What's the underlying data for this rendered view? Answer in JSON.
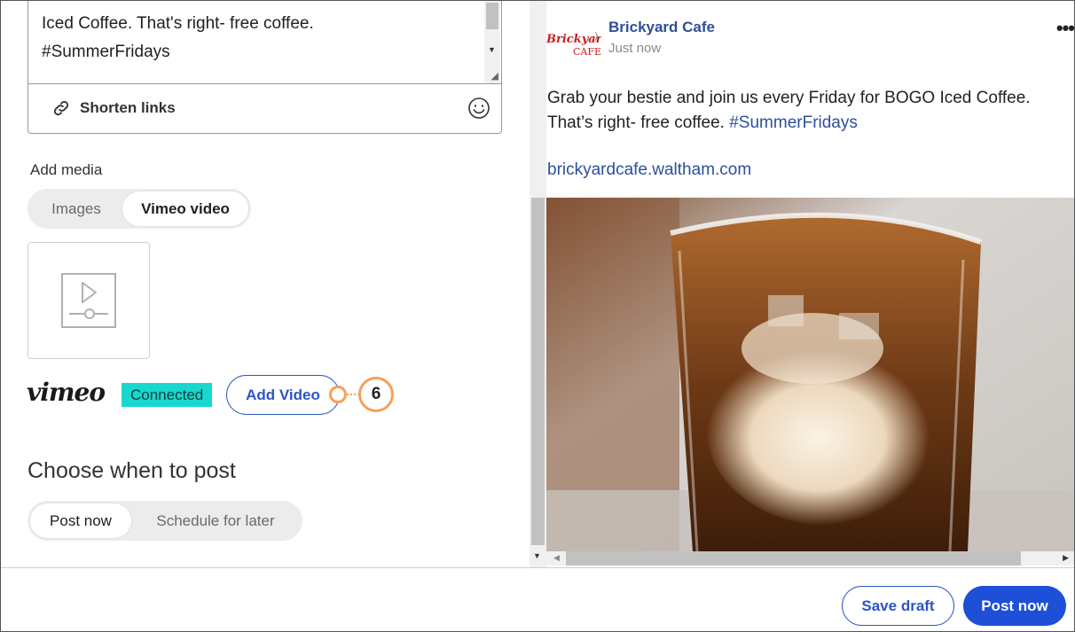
{
  "composer": {
    "text_lines": [
      "Iced Coffee. That's right- free coffee.",
      "#SummerFridays"
    ],
    "shorten_links_label": "Shorten links",
    "link_icon": "link-icon",
    "emoji_icon": "smiley-icon"
  },
  "media": {
    "label": "Add media",
    "tabs": [
      {
        "label": "Images",
        "selected": false
      },
      {
        "label": "Vimeo video",
        "selected": true
      }
    ],
    "thumb_icon": "video-placeholder-icon",
    "vimeo_logo_text": "vimeo",
    "connected_label": "Connected",
    "add_video_label": "Add Video",
    "callout_number": "6"
  },
  "schedule": {
    "title": "Choose when to post",
    "options": [
      {
        "label": "Post now",
        "selected": true
      },
      {
        "label": "Schedule for later",
        "selected": false
      }
    ]
  },
  "preview": {
    "page_name": "Brickyard Cafe",
    "time": "Just now",
    "logo_text_top": "Brickyard",
    "logo_text_bottom": "CAFE",
    "more_label": "•••",
    "body_text": "Grab your bestie and join us every Friday for BOGO Iced Coffee. That’s right- free coffee. ",
    "hashtag": "#SummerFridays",
    "link": "brickyardcafe.waltham.com",
    "image_icon": "iced-coffee-photo"
  },
  "footer": {
    "save_draft_label": "Save draft",
    "post_now_label": "Post now"
  },
  "colors": {
    "accent": "#1d4fd8",
    "link": "#2e4f9a",
    "connected": "#17d8cf",
    "callout": "#f5a05a"
  }
}
